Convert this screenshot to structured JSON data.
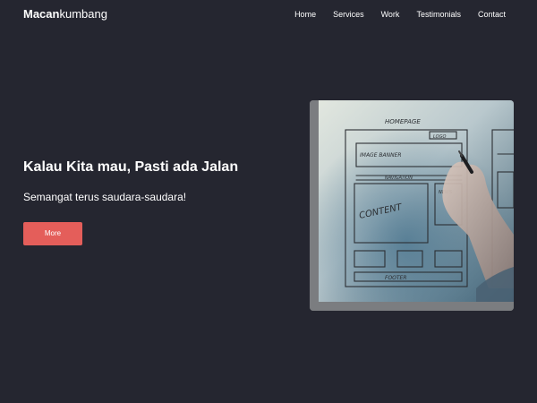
{
  "brand": {
    "bold": "Macan",
    "light": "kumbang"
  },
  "nav": {
    "items": [
      "Home",
      "Services",
      "Work",
      "Testimonials",
      "Contact"
    ]
  },
  "hero": {
    "title": "Kalau Kita mau, Pasti ada Jalan",
    "subtitle": "Semangat terus saudara-saudara!",
    "button_label": "More",
    "button_color": "#e45e5a"
  },
  "illustration": {
    "labels": {
      "homepage": "HOMEPAGE",
      "logo": "LOGO",
      "image_banner": "IMAGE BANNER",
      "navigation": "NAVIGATION",
      "content": "CONTENT",
      "news": "NEWS",
      "footer": "FOOTER"
    }
  },
  "colors": {
    "background": "#252630",
    "text": "#ffffff",
    "accent": "#e45e5a"
  }
}
